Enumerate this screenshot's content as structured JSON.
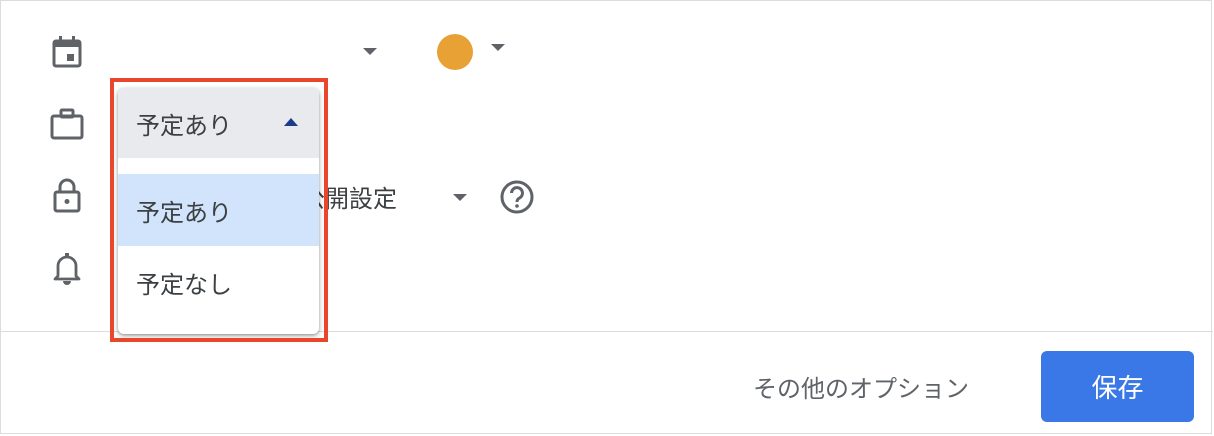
{
  "event_color": "#e8a135",
  "icons": {
    "calendar": "calendar-icon",
    "briefcase": "briefcase-icon",
    "lock": "lock-icon",
    "bell": "bell-icon",
    "help": "help-circle-icon"
  },
  "visibility": {
    "label_visible": "公開設定"
  },
  "availability_dropdown": {
    "selected": "予定あり",
    "options": [
      {
        "label": "予定あり",
        "selected": true
      },
      {
        "label": "予定なし",
        "selected": false
      }
    ]
  },
  "footer": {
    "more_options_label": "その他のオプション",
    "save_label": "保存"
  },
  "colors": {
    "accent": "#3b78e7",
    "highlight_border": "#e8472c",
    "selected_option_bg": "#d2e3fc"
  }
}
